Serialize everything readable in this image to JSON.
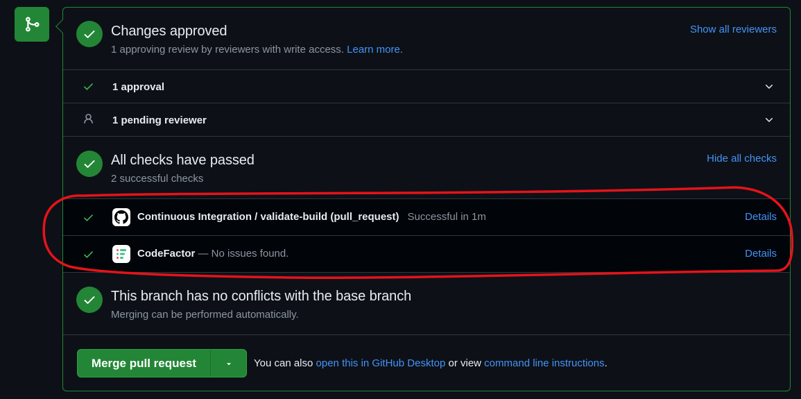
{
  "approval": {
    "title": "Changes approved",
    "subtitle": "1 approving review by reviewers with write access.",
    "learn_more": "Learn more",
    "subtitle_end": ".",
    "show_all": "Show all reviewers"
  },
  "reviews": [
    {
      "label": "1 approval",
      "icon": "check-icon"
    },
    {
      "label": "1 pending reviewer",
      "icon": "person-icon"
    }
  ],
  "checks": {
    "title": "All checks have passed",
    "subtitle": "2 successful checks",
    "hide_all": "Hide all checks",
    "items": [
      {
        "name": "Continuous Integration / validate-build (pull_request)",
        "status": "Successful in 1m",
        "details": "Details",
        "logo": "github-icon"
      },
      {
        "name": "CodeFactor",
        "status": "— No issues found.",
        "details": "Details",
        "logo": "codefactor-icon"
      }
    ]
  },
  "conflicts": {
    "title": "This branch has no conflicts with the base branch",
    "subtitle": "Merging can be performed automatically."
  },
  "merge": {
    "button_label": "Merge pull request",
    "note_prefix": "You can also",
    "desktop_link": "open this in GitHub Desktop",
    "note_middle": "or view",
    "cli_link": "command line instructions",
    "note_end": "."
  },
  "colors": {
    "success": "#238636",
    "link": "#4493f8",
    "annotation": "#e5131a",
    "background": "#0d1117"
  }
}
